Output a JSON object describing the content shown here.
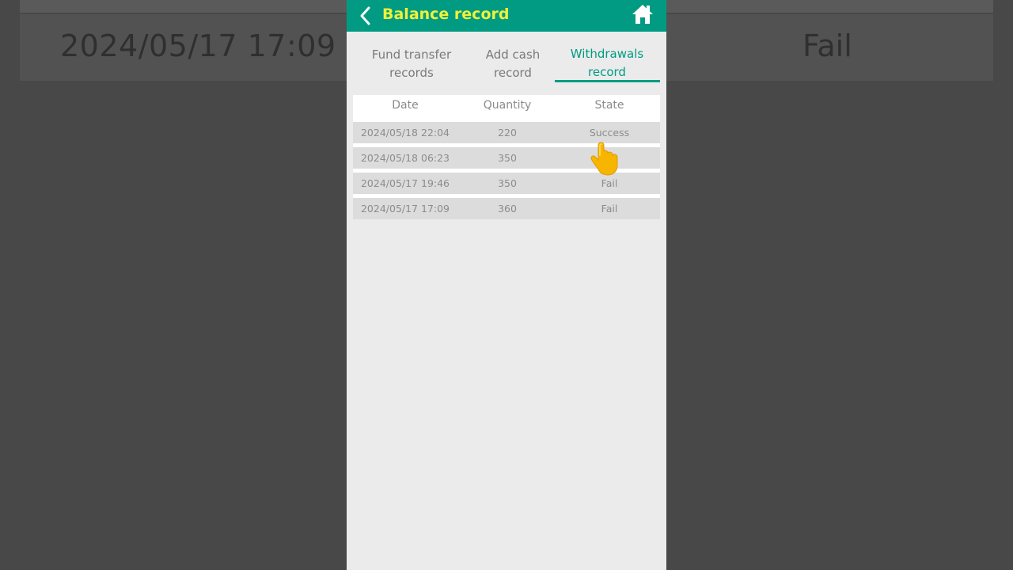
{
  "background": {
    "date": "2024/05/17 17:09",
    "state": "Fail"
  },
  "header": {
    "title": "Balance record",
    "title_color": "#eef23a",
    "bar_color": "#009b82",
    "back_icon": "chevron-left-icon",
    "home_icon": "home-icon"
  },
  "tabs": [
    {
      "line1": "Fund transfer",
      "line2": "records",
      "active": false
    },
    {
      "line1": "Add cash",
      "line2": "record",
      "active": false
    },
    {
      "line1": "Withdrawals",
      "line2": "record",
      "active": true
    }
  ],
  "table": {
    "columns": [
      "Date",
      "Quantity",
      "State"
    ],
    "rows": [
      {
        "date": "2024/05/18 22:04",
        "quantity": "220",
        "state": "Success"
      },
      {
        "date": "2024/05/18 06:23",
        "quantity": "350",
        "state": ""
      },
      {
        "date": "2024/05/17 19:46",
        "quantity": "350",
        "state": "Fail"
      },
      {
        "date": "2024/05/17 17:09",
        "quantity": "360",
        "state": "Fail"
      }
    ]
  }
}
